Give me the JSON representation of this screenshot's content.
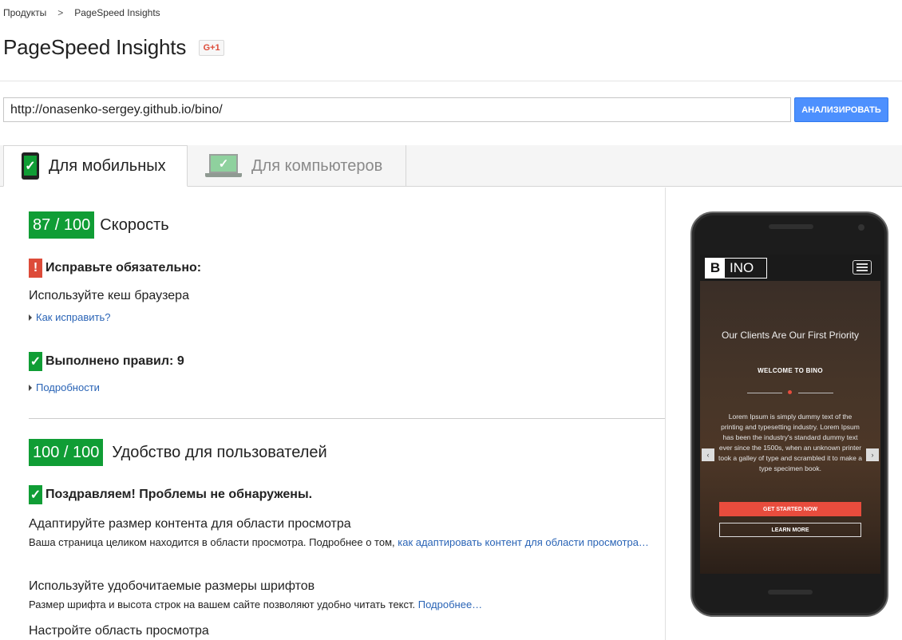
{
  "breadcrumb": {
    "parent": "Продукты",
    "separator": ">",
    "current": "PageSpeed Insights"
  },
  "header": {
    "title": "PageSpeed Insights",
    "gplus_label": "G+1"
  },
  "search": {
    "url_value": "http://onasenko-sergey.github.io/bino/",
    "analyze_label": "АНАЛИЗИРОВАТЬ"
  },
  "tabs": [
    {
      "label": "Для мобильных",
      "active": true
    },
    {
      "label": "Для компьютеров",
      "active": false
    }
  ],
  "speed": {
    "score": "87 / 100",
    "label": "Скорость",
    "must_fix_title": "Исправьте обязательно:",
    "must_fix_item": "Используйте кеш браузера",
    "how_to_fix_link": "Как исправить?",
    "passed_title": "Выполнено правил: 9",
    "details_link": "Подробности"
  },
  "usability": {
    "score": "100 / 100",
    "label": "Удобство для пользователей",
    "congrats": "Поздравляем! Проблемы не обнаружены.",
    "rule1_title": "Адаптируйте размер контента для области просмотра",
    "rule1_text": "Ваша страница целиком находится в области просмотра. Подробнее о том, ",
    "rule1_link": "как адаптировать контент для области просмотра…",
    "rule2_title": "Используйте удобочитаемые размеры шрифтов",
    "rule2_text": "Размер шрифта и высота строк на вашем сайте позволяют удобно читать текст. ",
    "rule2_link": "Подробнее…",
    "rule3_title": "Настройте область просмотра"
  },
  "preview": {
    "logo_b": "B",
    "logo_rest": "INO",
    "hero_title": "Our Clients Are Our First Priority",
    "welcome": "WELCOME TO BINO",
    "text": "Lorem Ipsum is simply dummy text of the printing and typesetting industry. Lorem Ipsum has been the industry's standard dummy text ever since the 1500s, when an unknown printer took a galley of type and scrambled it to make a type specimen book.",
    "btn_primary": "GET STARTED NOW",
    "btn_secondary": "LEARN MORE"
  },
  "colors": {
    "score_green": "#109d35",
    "alert_red": "#dd4b39",
    "button_blue": "#4d90fe",
    "link_blue": "#2a64b6"
  },
  "icons": {
    "check": "✓",
    "exclamation": "!",
    "arrow_left": "‹",
    "arrow_right": "›"
  }
}
